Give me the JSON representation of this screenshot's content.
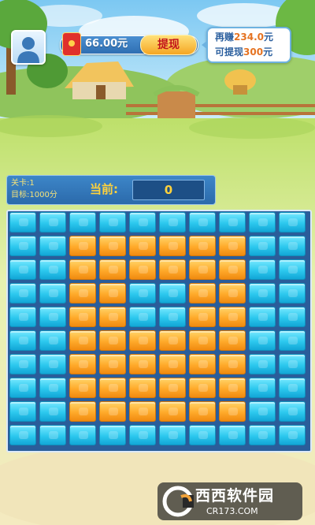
{
  "header": {
    "money_amount": "66.00元",
    "withdraw_label": "提现",
    "balance_label_1": "再赚",
    "balance_value_1": "234.0",
    "balance_unit_1": "元",
    "balance_label_2": "可提现",
    "balance_value_2": "300",
    "balance_unit_2": "元"
  },
  "level_panel": {
    "level_text": "关卡:1",
    "target_text": "目标:1000分",
    "current_label": "当前:",
    "current_score": "0"
  },
  "board": {
    "rows": 10,
    "cols": 10,
    "tiles": [
      "BBBBBBBBBB",
      "BBOOOOOOBB",
      "BBOOOOOOBB",
      "BBOOBBOOBB",
      "BBOOBBOOBB",
      "BBOOOOOOBB",
      "BBOOOOOOBB",
      "BBOOOOOOBB",
      "BBOOOOOOBB",
      "BBBBBBBBBB"
    ],
    "tile_colors": {
      "B": "#2cc8ee",
      "O": "#ffaa2a"
    }
  },
  "watermark": {
    "title": "西西软件园",
    "url": "CR173.COM"
  },
  "icons": {
    "avatar": "user-silhouette-icon",
    "money": "red-envelope-icon",
    "watermark_logo": "cr-logo-icon"
  }
}
